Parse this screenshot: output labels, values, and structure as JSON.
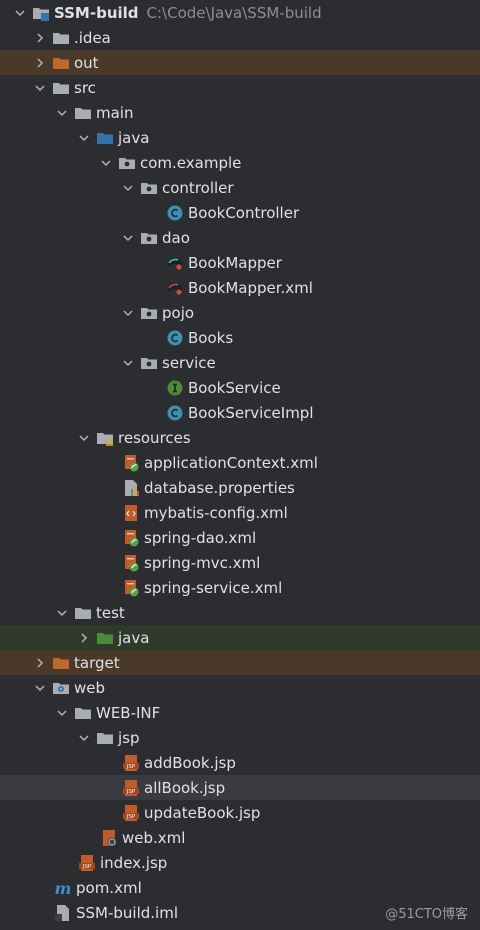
{
  "project": {
    "name": "SSM-build",
    "path": "C:\\Code\\Java\\SSM-build"
  },
  "tree": {
    "idea": ".idea",
    "out": "out",
    "src": "src",
    "main": "main",
    "java": "java",
    "package": "com.example",
    "controller": "controller",
    "book_controller": "BookController",
    "dao": "dao",
    "book_mapper": "BookMapper",
    "book_mapper_xml": "BookMapper.xml",
    "pojo": "pojo",
    "books": "Books",
    "service": "service",
    "book_service": "BookService",
    "book_service_impl": "BookServiceImpl",
    "resources": "resources",
    "application_context": "applicationContext.xml",
    "database_properties": "database.properties",
    "mybatis_config": "mybatis-config.xml",
    "spring_dao": "spring-dao.xml",
    "spring_mvc": "spring-mvc.xml",
    "spring_service": "spring-service.xml",
    "test": "test",
    "test_java": "java",
    "target": "target",
    "web": "web",
    "web_inf": "WEB-INF",
    "jsp": "jsp",
    "add_book": "addBook.jsp",
    "all_book": "allBook.jsp",
    "update_book": "updateBook.jsp",
    "web_xml": "web.xml",
    "index_jsp": "index.jsp",
    "pom": "pom.xml",
    "iml": "SSM-build.iml"
  },
  "watermark": "@51CTO博客",
  "colors": {
    "background": "#2b2d30",
    "excluded_row": "#4a3828",
    "test_row": "#2f3a2c",
    "selected_row": "#393b40",
    "class_icon": "#3f8fb0",
    "interface_icon": "#4d8a3c",
    "folder": "#a9adb3",
    "excluded_folder": "#c0672c",
    "source_folder": "#3574a8",
    "test_folder": "#4c8b3a"
  }
}
